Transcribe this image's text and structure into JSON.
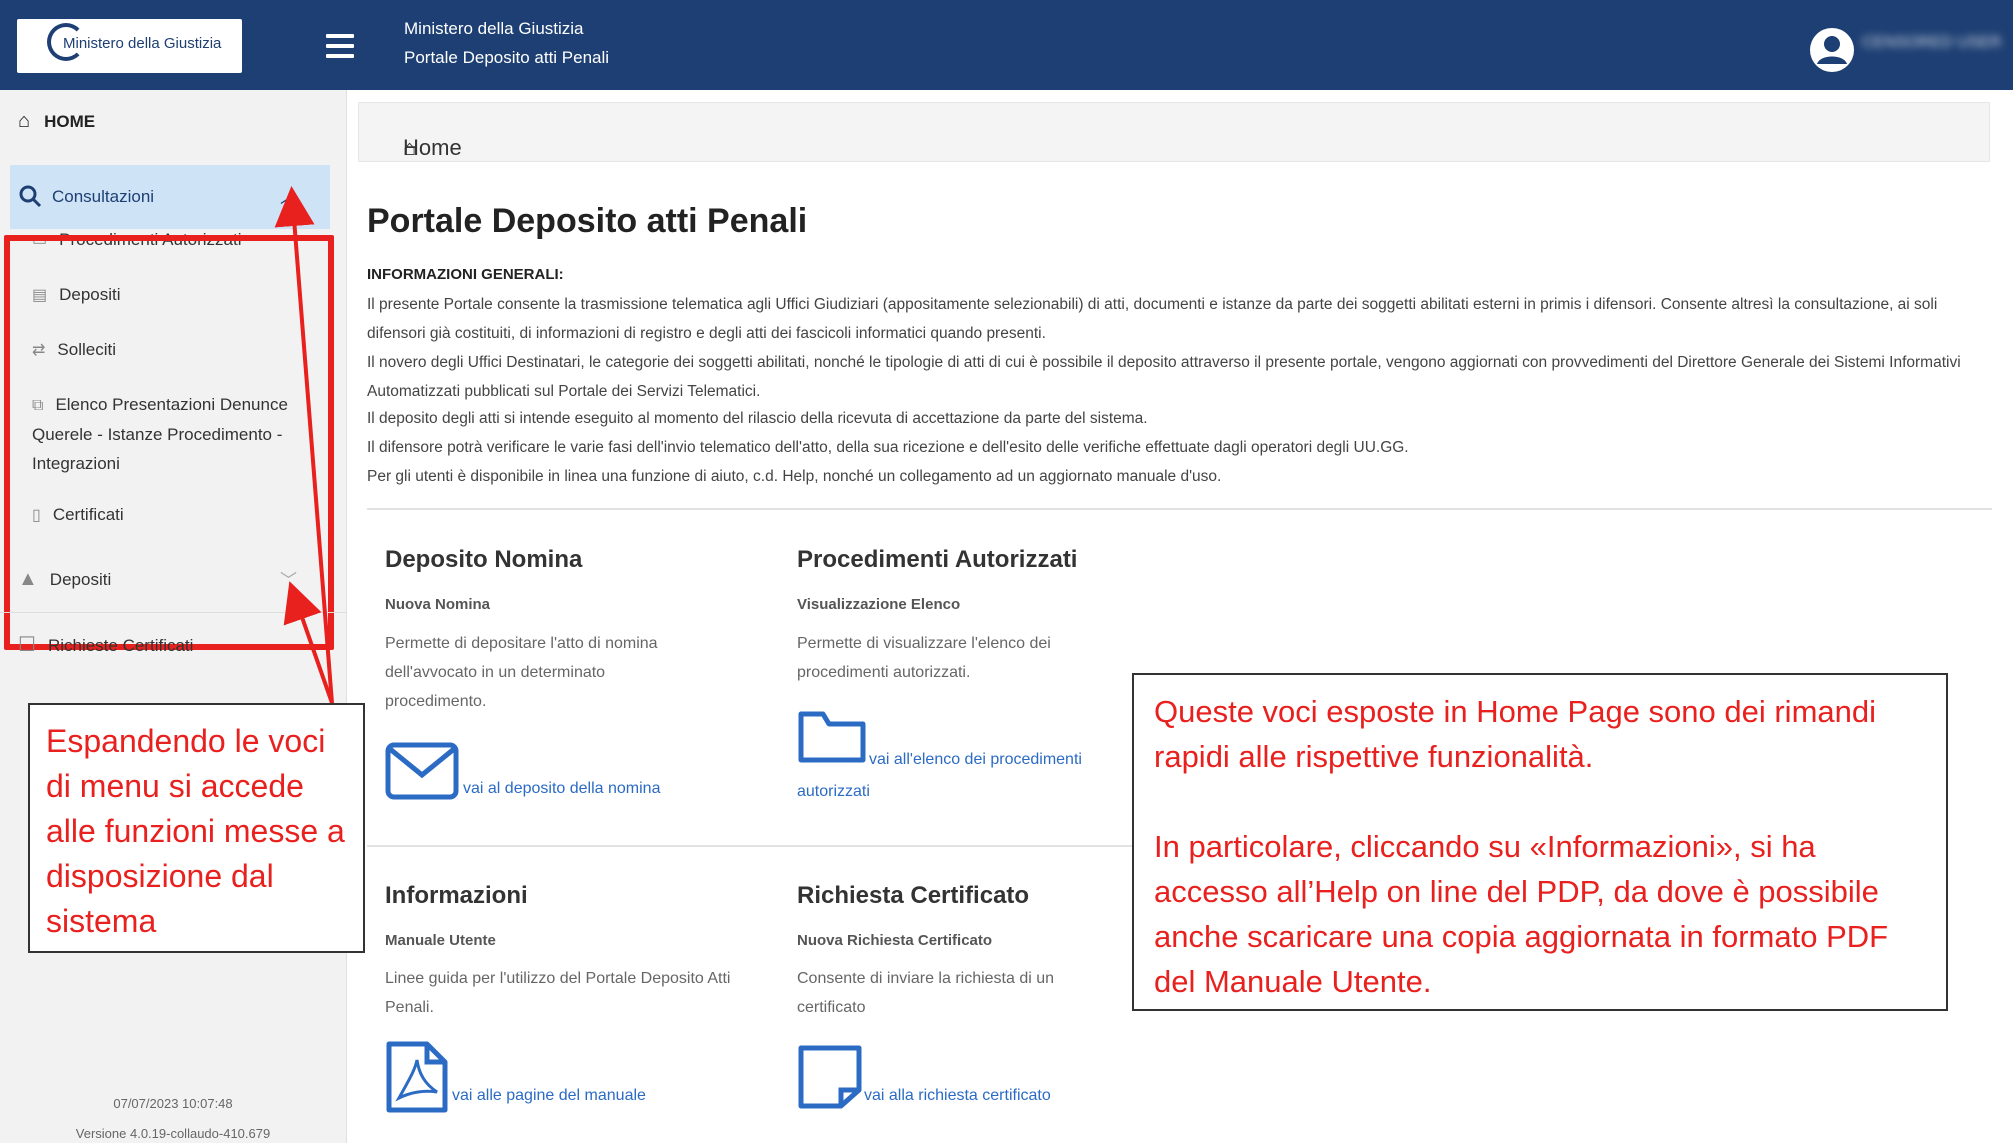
{
  "header": {
    "logo_text": "Ministero della Giustizia",
    "title_line1": "Ministero della Giustizia",
    "title_line2": "Portale Deposito atti Penali",
    "user_name": "CENSORED USER"
  },
  "sidebar": {
    "home": "HOME",
    "consultazioni": "Consultazioni",
    "sub_items": [
      {
        "label": "Procedimenti Autorizzati",
        "icon": "folder-icon"
      },
      {
        "label": "Depositi",
        "icon": "inbox-icon"
      },
      {
        "label": "Solleciti",
        "icon": "exchange-icon"
      },
      {
        "label": "Elenco Presentazioni Denunce Querele - Istanze Procedimento - Integrazioni",
        "icon": "copy-icon"
      },
      {
        "label": "Certificati",
        "icon": "file-icon"
      }
    ],
    "depositi": "Depositi",
    "richieste_certificati": "Richieste Certificati",
    "footer_date": "07/07/2023 10:07:48",
    "footer_version": "Versione 4.0.19-collaudo-410.679"
  },
  "breadcrumb": {
    "home": "Home"
  },
  "main": {
    "title": "Portale Deposito atti Penali",
    "info_heading": "INFORMAZIONI GENERALI:",
    "paragraphs": [
      "Il presente Portale consente la trasmissione telematica agli Uffici Giudiziari (appositamente selezionabili) di atti, documenti e istanze da parte dei soggetti abilitati esterni in primis i difensori. Consente altresì la consultazione, ai soli difensori già costituiti, di informazioni di registro e degli atti dei fascicoli informatici quando presenti.",
      "Il novero degli Uffici Destinatari, le categorie dei soggetti abilitati, nonché le tipologie di atti di cui è possibile il deposito attraverso il presente portale, vengono aggiornati con provvedimenti del Direttore Generale dei Sistemi Informativi Automatizzati pubblicati sul Portale dei Servizi Telematici.",
      "Il deposito degli atti si intende eseguito al momento del rilascio della ricevuta di accettazione da parte del sistema.",
      "Il difensore potrà verificare le varie fasi dell'invio telematico dell'atto, della sua ricezione e dell'esito delle verifiche effettuate dagli operatori degli UU.GG.",
      "Per gli utenti è disponibile in linea una funzione di aiuto, c.d. Help, nonché un collegamento ad un aggiornato manuale d'uso."
    ],
    "cards": [
      {
        "title": "Deposito Nomina",
        "subtitle": "Nuova Nomina",
        "desc": "Permette di depositare l'atto di nomina dell'avvocato in un determinato procedimento.",
        "link": "vai al deposito della nomina",
        "icon": "envelope-icon"
      },
      {
        "title": "Procedimenti Autorizzati",
        "subtitle": "Visualizzazione Elenco",
        "desc": "Permette di visualizzare l'elenco dei procedimenti autorizzati.",
        "link": "vai all'elenco dei procedimenti autorizzati",
        "icon": "folder-icon"
      },
      {
        "title": "Informazioni",
        "subtitle": "Manuale Utente",
        "desc": "Linee guida per l'utilizzo del Portale Deposito Atti Penali.",
        "link": "vai alle pagine del manuale",
        "icon": "pdf-icon"
      },
      {
        "title": "Richiesta Certificato",
        "subtitle": "Nuova Richiesta Certificato",
        "desc": "Consente di inviare la richiesta di un certificato",
        "link": "vai alla richiesta certificato",
        "icon": "note-icon"
      }
    ]
  },
  "annotations": {
    "left": "Espandendo le voci di menu si accede alle funzioni messe a disposizione dal sistema",
    "right_p1": "Queste voci esposte in Home Page sono dei rimandi rapidi alle rispettive funzionalità.",
    "right_p2": "In particolare, cliccando su «Informazioni», si ha accesso all’Help on line del PDP, da dove è possibile anche scaricare una copia aggiornata in formato PDF del Manuale Utente."
  },
  "colors": {
    "header": "#1d3f73",
    "highlight": "#e8201e",
    "link": "#2b6bc4",
    "selected": "#cfe3f6"
  }
}
